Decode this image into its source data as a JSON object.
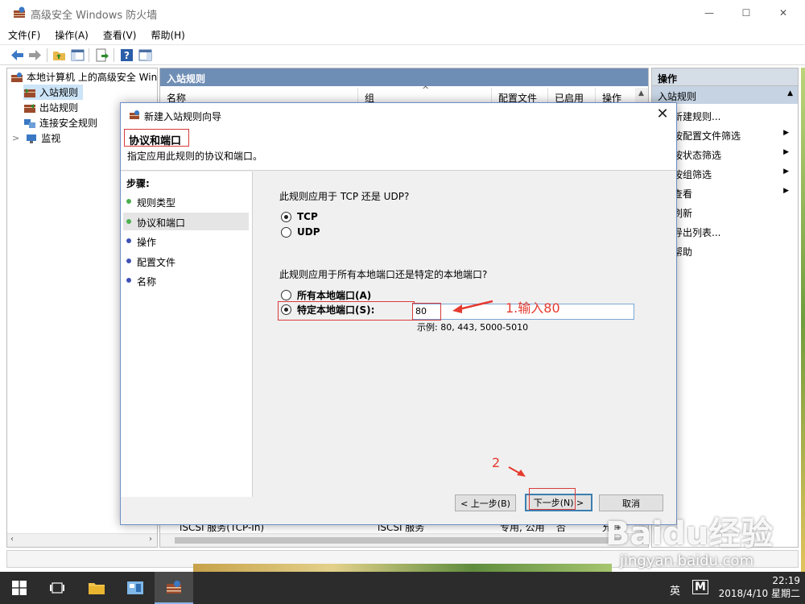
{
  "window": {
    "title": "高级安全 Windows 防火墙",
    "controls": {
      "minimize": "—",
      "maximize": "☐",
      "close": "✕"
    }
  },
  "menu": [
    "文件(F)",
    "操作(A)",
    "查看(V)",
    "帮助(H)"
  ],
  "tree": {
    "root": "本地计算机 上的高级安全 Windo",
    "items": [
      "入站规则",
      "出站规则",
      "连接安全规则",
      "监视"
    ],
    "expander": ">"
  },
  "center": {
    "header": "入站规则",
    "columns": [
      "名称",
      "组",
      "配置文件",
      "已启用",
      "操作"
    ],
    "sort_arrow": "^",
    "bottom_row": [
      "iSCSI 服务(TCP-In)",
      "iSCSI 服务",
      "专用, 公用",
      "否",
      "允许"
    ]
  },
  "actions": {
    "header": "操作",
    "section": "入站规则",
    "items": [
      {
        "label": "新建规则...",
        "submenu": false
      },
      {
        "label": "按配置文件筛选",
        "submenu": true
      },
      {
        "label": "按状态筛选",
        "submenu": true
      },
      {
        "label": "按组筛选",
        "submenu": true
      },
      {
        "label": "查看",
        "submenu": true
      },
      {
        "label": "刷新",
        "submenu": false
      },
      {
        "label": "导出列表...",
        "submenu": false
      },
      {
        "label": "帮助",
        "submenu": false
      }
    ]
  },
  "dialog": {
    "title": "新建入站规则向导",
    "close": "✕",
    "heading": "协议和端口",
    "subheading": "指定应用此规则的协议和端口。",
    "steps_caption": "步骤:",
    "steps": [
      {
        "label": "规则类型",
        "color": "#4caf50"
      },
      {
        "label": "协议和端口",
        "color": "#4caf50"
      },
      {
        "label": "操作",
        "color": "#3f51b5"
      },
      {
        "label": "配置文件",
        "color": "#3f51b5"
      },
      {
        "label": "名称",
        "color": "#3f51b5"
      }
    ],
    "q_protocol": "此规则应用于 TCP 还是 UDP?",
    "tcp": "TCP",
    "udp": "UDP",
    "q_ports": "此规则应用于所有本地端口还是特定的本地端口?",
    "all_ports": "所有本地端口(A)",
    "specific_ports": "特定本地端口(S):",
    "port_value": "80",
    "port_hint": "示例: 80, 443, 5000-5010",
    "back": "< 上一步(B)",
    "next": "下一步(N) >",
    "cancel": "取消"
  },
  "annotations": {
    "step1": "1.输入80",
    "step2": "2",
    "color": "#e53a2f"
  },
  "taskbar": {
    "time": "22:19",
    "date": "2018/4/10 星期二",
    "ime": "英",
    "ime2": "M",
    "bg": "#2c2c2c"
  },
  "watermark": {
    "logo": "Baidu经验",
    "url": "jingyan.baidu.com"
  }
}
